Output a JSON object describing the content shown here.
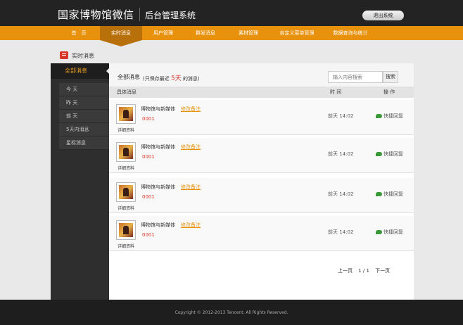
{
  "header": {
    "title": "国家博物馆微信",
    "subtitle": "后台管理系统",
    "logout_label": "退出系统"
  },
  "nav": {
    "items": [
      {
        "label": "首　页"
      },
      {
        "label": "实时消息"
      },
      {
        "label": "用户管理"
      },
      {
        "label": "群发消息"
      },
      {
        "label": "素材管理"
      },
      {
        "label": "自定义菜单管理"
      },
      {
        "label": "数据查询与统计"
      }
    ],
    "active_index": 1
  },
  "breadcrumb": {
    "label": "实时消息",
    "icon": "message-icon"
  },
  "sidebar": {
    "header": "全部消息",
    "items": [
      {
        "label": "今  天"
      },
      {
        "label": "昨  天"
      },
      {
        "label": "前  天"
      },
      {
        "label": "5天内消息"
      },
      {
        "label": "星标消息"
      }
    ]
  },
  "panel": {
    "title": "全部消息",
    "note_prefix": "(只保存最近",
    "note_num": "5天",
    "note_suffix": "的消息)",
    "search_placeholder": "输入内容搜索",
    "search_button": "搜索"
  },
  "columns": {
    "content": "具体消息",
    "time": "时  间",
    "action": "操  作"
  },
  "messages": [
    {
      "sender": "博物馆与新媒体",
      "edit_label": "修改备注",
      "content": "0001",
      "detail_label": "详细资料",
      "time": "前天 14:02",
      "reply_label": "快捷回复"
    },
    {
      "sender": "博物馆与新媒体",
      "edit_label": "修改备注",
      "content": "0001",
      "detail_label": "详细资料",
      "time": "前天 14:02",
      "reply_label": "快捷回复"
    },
    {
      "sender": "博物馆与新媒体",
      "edit_label": "修改备注",
      "content": "0001",
      "detail_label": "详细资料",
      "time": "前天 14:02",
      "reply_label": "快捷回复"
    },
    {
      "sender": "博物馆与新媒体",
      "edit_label": "修改备注",
      "content": "0001",
      "detail_label": "详细资料",
      "time": "前天 14:02",
      "reply_label": "快捷回复"
    }
  ],
  "pagination": {
    "prev": "上一页",
    "page_info": "1 / 1",
    "next": "下一页"
  },
  "footer": {
    "copyright": "Copyright © 2012-2013 Tencent. All Rights Reserved."
  },
  "colors": {
    "accent": "#e8910c",
    "nav_active": "#b8700a",
    "highlight_red": "#d8342a",
    "dark_bg": "#232323"
  }
}
